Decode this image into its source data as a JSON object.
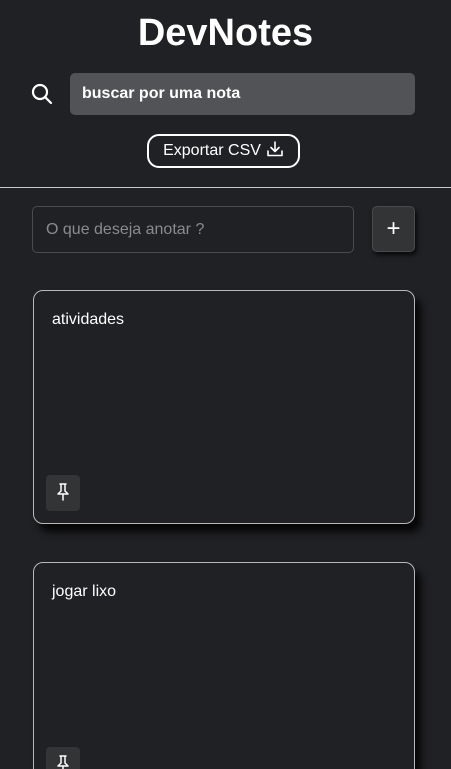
{
  "header": {
    "title": "DevNotes"
  },
  "search": {
    "icon": "search-icon",
    "placeholder": "buscar por uma nota",
    "value": ""
  },
  "export": {
    "label": "Exportar CSV",
    "icon": "download-icon"
  },
  "new_note": {
    "placeholder": "O que deseja anotar ?",
    "value": "",
    "add_label": "+"
  },
  "notes": [
    {
      "text": "atividades",
      "pin_icon": "pin-icon"
    },
    {
      "text": "jogar lixo",
      "pin_icon": "pin-icon"
    }
  ],
  "colors": {
    "background": "#202124",
    "search_bg": "#525356",
    "button_bg": "#333436",
    "text": "#ffffff",
    "border": "#b9b9b9"
  }
}
